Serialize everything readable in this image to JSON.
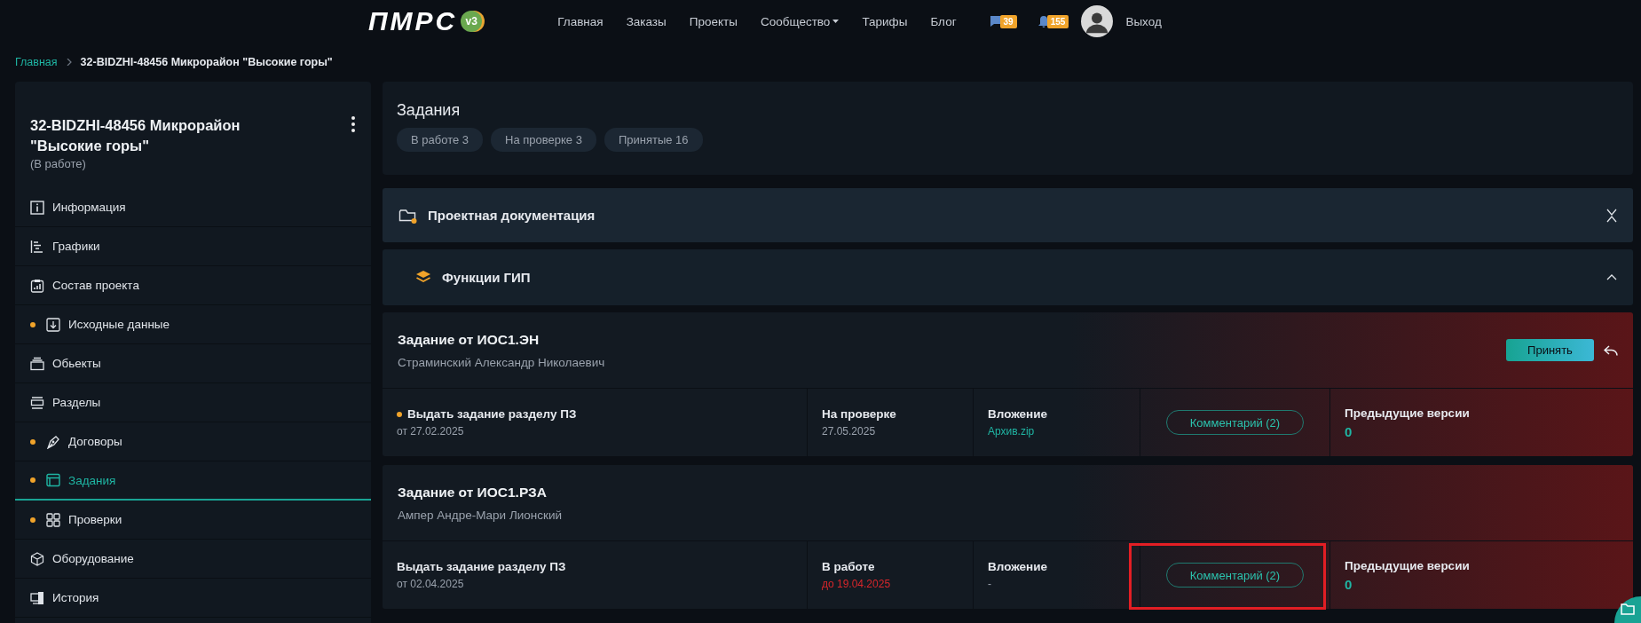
{
  "header": {
    "logo": {
      "text": "ПМРС",
      "version": "v3"
    },
    "nav": [
      {
        "label": "Главная",
        "dropdown": false
      },
      {
        "label": "Заказы",
        "dropdown": false
      },
      {
        "label": "Проекты",
        "dropdown": false
      },
      {
        "label": "Сообщество",
        "dropdown": true
      },
      {
        "label": "Тарифы",
        "dropdown": false
      },
      {
        "label": "Блог",
        "dropdown": false
      }
    ],
    "messages_count": "39",
    "notifications_count": "155",
    "logout": "Выход"
  },
  "breadcrumb": [
    "Главная",
    "32-BIDZHI-48456 Микрорайон \"Высокие горы\""
  ],
  "sidebar": {
    "title": "32-BIDZHI-48456 Микрорайон \"Высокие горы\"",
    "status": "(В работе)",
    "items": [
      {
        "label": "Информация",
        "kind": "info",
        "dot": false,
        "selected": false
      },
      {
        "label": "Графики",
        "kind": "gantt",
        "dot": false,
        "selected": false
      },
      {
        "label": "Состав проекта",
        "kind": "clipboard",
        "dot": false,
        "selected": false
      },
      {
        "label": "Исходные данные",
        "kind": "download",
        "dot": true,
        "selected": false
      },
      {
        "label": "Обьекты",
        "kind": "stack",
        "dot": false,
        "selected": false
      },
      {
        "label": "Разделы",
        "kind": "sections",
        "dot": false,
        "selected": false
      },
      {
        "label": "Договоры",
        "kind": "pen",
        "dot": true,
        "selected": false
      },
      {
        "label": "Задания",
        "kind": "window",
        "dot": true,
        "selected": true
      },
      {
        "label": "Проверки",
        "kind": "grid",
        "dot": true,
        "selected": false
      },
      {
        "label": "Оборудование",
        "kind": "cube",
        "dot": false,
        "selected": false
      },
      {
        "label": "История",
        "kind": "devices",
        "dot": false,
        "selected": false
      }
    ]
  },
  "tasks_panel": {
    "title": "Задания",
    "filters": [
      {
        "label": "В работе",
        "count": "3"
      },
      {
        "label": "На проверке",
        "count": "3"
      },
      {
        "label": "Принятые",
        "count": "16"
      }
    ]
  },
  "sections": [
    {
      "title": "Проектная документация",
      "kind": "folder",
      "expanded": false
    },
    {
      "title": "Функции ГИП",
      "kind": "layers",
      "expanded": true
    }
  ],
  "tasks": [
    {
      "title": "Задание от ИОС1.ЭН",
      "author": "Страминский Александр Николаевич",
      "accept": "Принять",
      "item": {
        "title": "Выдать задание разделу ПЗ",
        "date": "от 27.02.2025",
        "dot": true
      },
      "status": {
        "label": "На проверке",
        "date": "27.05.2025",
        "overdue": false
      },
      "attachment": {
        "label": "Вложение",
        "value": "Архив.zip",
        "link": true
      },
      "comment": "Комментарий (2)",
      "previous": {
        "label": "Предыдущие версии",
        "value": "0"
      },
      "highlighted": false
    },
    {
      "title": "Задание от ИОС1.РЗА",
      "author": "Ампер Андре-Мари Лионский",
      "item": {
        "title": "Выдать задание разделу ПЗ",
        "date": "от 02.04.2025",
        "dot": false
      },
      "status": {
        "label": "В работе",
        "date": "до 19.04.2025",
        "overdue": true
      },
      "attachment": {
        "label": "Вложение",
        "value": "-",
        "link": false
      },
      "comment": "Комментарий (2)",
      "previous": {
        "label": "Предыдущие версии",
        "value": "0"
      },
      "highlighted": true
    }
  ]
}
